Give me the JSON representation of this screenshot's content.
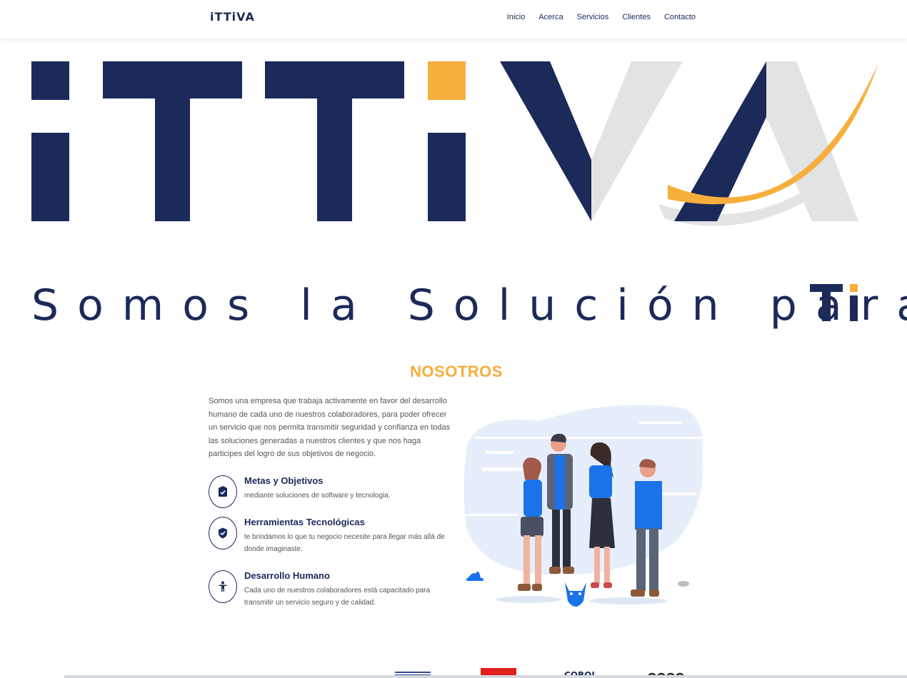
{
  "nav": {
    "logo_text": "iTTiVA",
    "links": [
      "Inicio",
      "Acerca",
      "Servicios",
      "Clientes",
      "Contacto"
    ]
  },
  "hero": {
    "logo_text": "iTTiVA",
    "tagline": "Somos la Solución para",
    "tagline_highlight": "Ti"
  },
  "nosotros": {
    "title": "NOSOTROS",
    "intro": "Somos una empresa que trabaja activamente en favor del desarrollo humano de cada uno de nuestros colaboradores, para poder ofrecer un servicio que nos permita transmitir seguridad y confianza en todas las soluciones generadas a nuestros clientes y que nos haga participes del logro de sus objetivos de negocio.",
    "features": [
      {
        "title": "Metas y Objetivos",
        "desc": "mediante soluciones de software y tecnologia.",
        "icon": "clipboard-check-icon"
      },
      {
        "title": "Herramientas Tecnológicas",
        "desc": "te brindamos lo que tu negocio necesite para llegar más allá de donde imaginaste.",
        "icon": "shield-check-icon"
      },
      {
        "title": "Desarrollo Humano",
        "desc": "Cada uno de nuestros colaboradores está capacitado para transmitir un servicio seguro y de calidad.",
        "icon": "person-icon"
      }
    ]
  },
  "clients": {
    "logos": [
      "IBM",
      "COBOL",
      "node"
    ]
  },
  "colors": {
    "navy": "#1b2a59",
    "gold": "#f7ae3c",
    "light_gray": "#e2e3e4",
    "people_blue": "#1a73e8"
  }
}
